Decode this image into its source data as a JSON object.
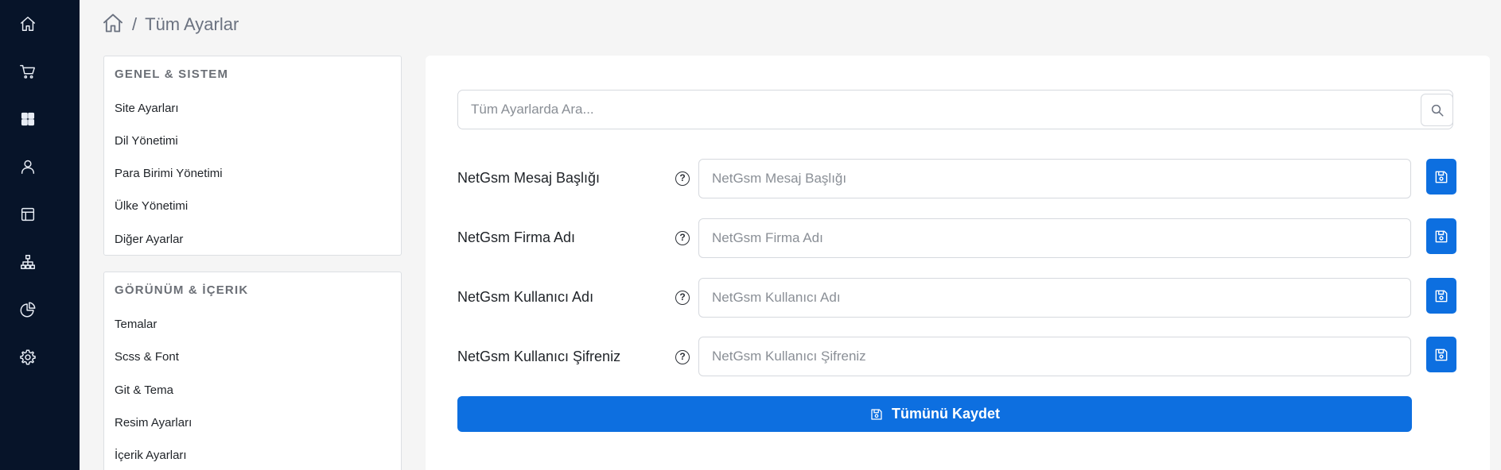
{
  "sidebar": {
    "icons": [
      "home-icon",
      "cart-icon",
      "grid-icon",
      "user-icon",
      "layout-icon",
      "sitemap-icon",
      "pie-chart-icon",
      "settings-icon"
    ]
  },
  "breadcrumb": {
    "separator": "/",
    "title": "Tüm Ayarlar"
  },
  "settings_menu": {
    "general": {
      "heading": "GENEL & SISTEM",
      "items": [
        "Site Ayarları",
        "Dil Yönetimi",
        "Para Birimi Yönetimi",
        "Ülke Yönetimi",
        "Diğer Ayarlar"
      ]
    },
    "appearance": {
      "heading": "GÖRÜNÜM & İÇERIK",
      "items": [
        "Temalar",
        "Scss & Font",
        "Git & Tema",
        "Resim Ayarları",
        "İçerik Ayarları"
      ]
    }
  },
  "search": {
    "placeholder": "Tüm Ayarlarda Ara..."
  },
  "fields": [
    {
      "label": "NetGsm Mesaj Başlığı",
      "placeholder": "NetGsm Mesaj Başlığı",
      "value": ""
    },
    {
      "label": "NetGsm Firma Adı",
      "placeholder": "NetGsm Firma Adı",
      "value": ""
    },
    {
      "label": "NetGsm Kullanıcı Adı",
      "placeholder": "NetGsm Kullanıcı Adı",
      "value": ""
    },
    {
      "label": "NetGsm Kullanıcı Şifreniz",
      "placeholder": "NetGsm Kullanıcı Şifreniz",
      "value": ""
    }
  ],
  "help_glyph": "?",
  "save_all_label": "Tümünü Kaydet",
  "colors": {
    "rail": "#071429",
    "primary": "#0d6fe0",
    "background": "#f5f5f5"
  }
}
